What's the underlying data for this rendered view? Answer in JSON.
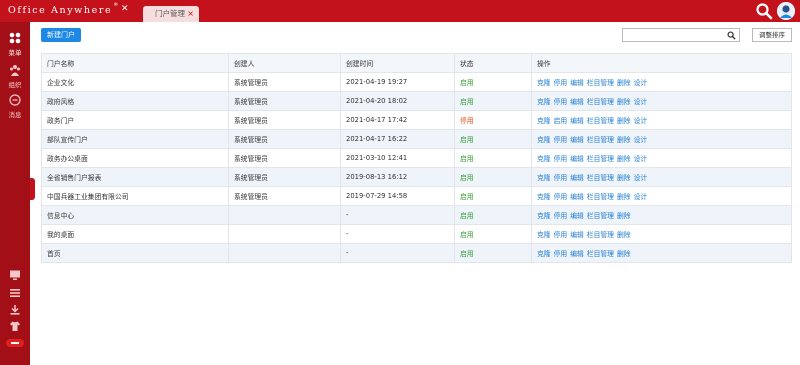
{
  "header": {
    "logo": "Office Anywhere",
    "logo_mark": "®",
    "tab_label": "门户管理"
  },
  "sidebar": {
    "items": [
      {
        "label": "菜单",
        "icon": "grid-icon"
      },
      {
        "label": "组织",
        "icon": "org-icon"
      },
      {
        "label": "消息",
        "icon": "message-icon"
      }
    ],
    "tools": [
      "monitor-icon",
      "list-icon",
      "download-icon",
      "shirt-icon",
      "toggle-pill-icon"
    ]
  },
  "toolbar": {
    "new_label": "新建门户",
    "search_placeholder": "",
    "sort_label": "调整排序"
  },
  "table": {
    "headers": [
      "门户名称",
      "创建人",
      "创建时间",
      "状态",
      "操作"
    ],
    "rows": [
      {
        "name": "企业文化",
        "creator": "系统管理员",
        "time": "2021-04-19 19:27",
        "status": "启用",
        "status_type": "on",
        "ops": [
          "克隆",
          "停用",
          "编辑",
          "栏目管理",
          "删除",
          "设计"
        ]
      },
      {
        "name": "政府风格",
        "creator": "系统管理员",
        "time": "2021-04-20 18:02",
        "status": "启用",
        "status_type": "on",
        "ops": [
          "克隆",
          "停用",
          "编辑",
          "栏目管理",
          "删除",
          "设计"
        ]
      },
      {
        "name": "政务门户",
        "creator": "系统管理员",
        "time": "2021-04-17 17:42",
        "status": "停用",
        "status_type": "off",
        "ops": [
          "克隆",
          "启用",
          "编辑",
          "栏目管理",
          "删除",
          "设计"
        ]
      },
      {
        "name": "部队宣传门户",
        "creator": "系统管理员",
        "time": "2021-04-17 16:22",
        "status": "启用",
        "status_type": "on",
        "ops": [
          "克隆",
          "停用",
          "编辑",
          "栏目管理",
          "删除",
          "设计"
        ]
      },
      {
        "name": "政务办公桌面",
        "creator": "系统管理员",
        "time": "2021-03-10 12:41",
        "status": "启用",
        "status_type": "on",
        "ops": [
          "克隆",
          "停用",
          "编辑",
          "栏目管理",
          "删除",
          "设计"
        ]
      },
      {
        "name": "全省销售门户报表",
        "creator": "系统管理员",
        "time": "2019-08-13 16:12",
        "status": "启用",
        "status_type": "on",
        "ops": [
          "克隆",
          "停用",
          "编辑",
          "栏目管理",
          "删除",
          "设计"
        ]
      },
      {
        "name": "中国兵器工业集团有限公司",
        "creator": "系统管理员",
        "time": "2019-07-29 14:58",
        "status": "启用",
        "status_type": "on",
        "ops": [
          "克隆",
          "停用",
          "编辑",
          "栏目管理",
          "删除",
          "设计"
        ]
      },
      {
        "name": "信息中心",
        "creator": "",
        "time": "-",
        "status": "启用",
        "status_type": "on",
        "ops": [
          "克隆",
          "停用",
          "编辑",
          "栏目管理",
          "删除"
        ]
      },
      {
        "name": "我的桌面",
        "creator": "",
        "time": "-",
        "status": "启用",
        "status_type": "on",
        "ops": [
          "克隆",
          "停用",
          "编辑",
          "栏目管理",
          "删除"
        ]
      },
      {
        "name": "首页",
        "creator": "",
        "time": "-",
        "status": "启用",
        "status_type": "on",
        "ops": [
          "克隆",
          "停用",
          "编辑",
          "栏目管理",
          "删除"
        ]
      }
    ]
  },
  "colors": {
    "brand": "#c3121c",
    "sidebar": "#a20f17",
    "accent": "#1e88e5",
    "enabled": "#2e9a2e",
    "disabled": "#e14a16",
    "link": "#1e7bd1"
  }
}
